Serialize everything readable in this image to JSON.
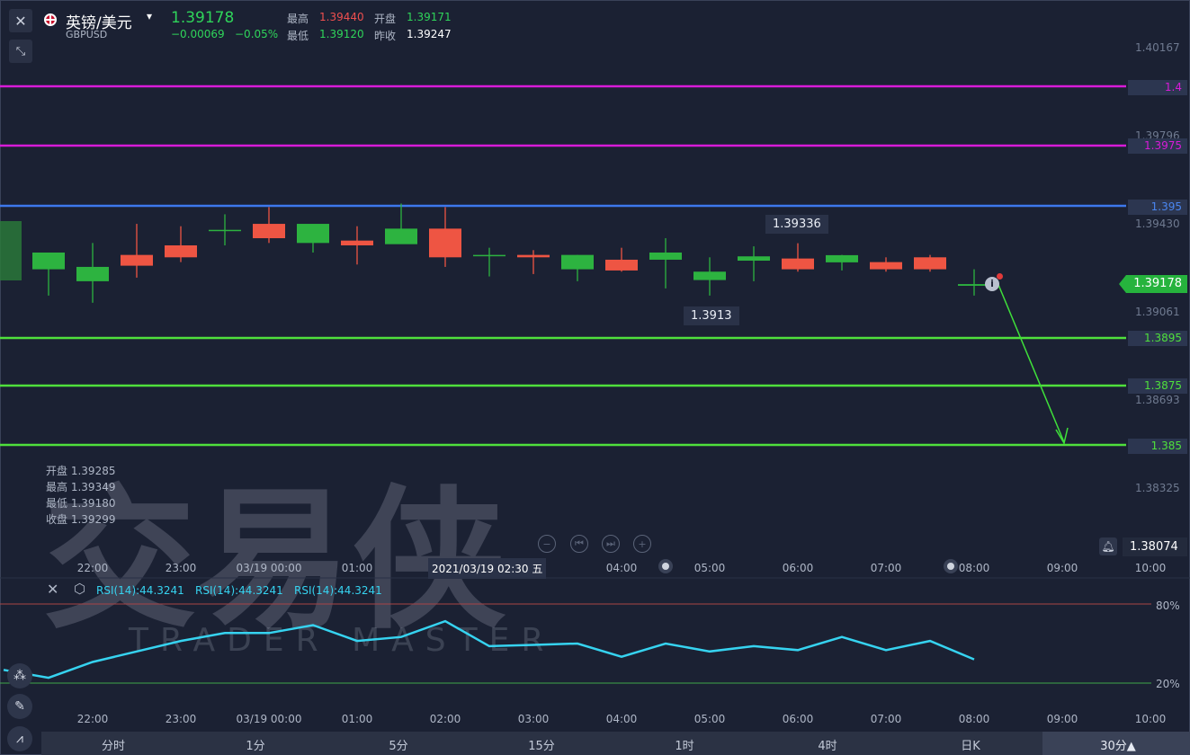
{
  "header": {
    "name": "英镑/美元",
    "caret": "▾",
    "code": "GBPUSD",
    "price": "1.39178",
    "change": "−0.00069",
    "change_pct": "−0.05%",
    "high_label": "最高",
    "high": "1.39440",
    "open_label": "开盘",
    "open": "1.39171",
    "low_label": "最低",
    "low": "1.39120",
    "prev_label": "昨收",
    "prev": "1.39247"
  },
  "axis": {
    "ticks": [
      "1.40167",
      "1.39796",
      "1.39430",
      "1.39061",
      "1.38693",
      "1.38325"
    ],
    "current": "1.39178",
    "alert_price": "1.38074"
  },
  "levels": [
    {
      "label": "1.4",
      "color": "#d81bd8"
    },
    {
      "label": "1.3975",
      "color": "#d81bd8"
    },
    {
      "label": "1.395",
      "color": "#3d78ec"
    },
    {
      "label": "1.3895",
      "color": "#4fe03c"
    },
    {
      "label": "1.3875",
      "color": "#4fe03c"
    },
    {
      "label": "1.385",
      "color": "#4fe03c"
    }
  ],
  "annotations": {
    "high_mark": "1.39336",
    "low_mark": "1.3913"
  },
  "ohlc": [
    {
      "label": "开盘",
      "value": "1.39285"
    },
    {
      "label": "最高",
      "value": "1.39349"
    },
    {
      "label": "最低",
      "value": "1.39180"
    },
    {
      "label": "收盘",
      "value": "1.39299"
    }
  ],
  "time_axis": {
    "labels": [
      "22:00",
      "23:00",
      "03/19 00:00",
      "01:00",
      "02:00",
      "03:00",
      "04:00",
      "05:00",
      "06:00",
      "07:00",
      "08:00",
      "09:00",
      "10:00"
    ],
    "crosshair": "2021/03/19 02:30 五"
  },
  "rsi": {
    "labels": [
      "RSI(14):44.3241",
      "RSI(14):44.3241",
      "RSI(14):44.3241"
    ],
    "upper": "80%",
    "lower": "20%",
    "color": "#36d3f0"
  },
  "watermark": {
    "text": "交易侠",
    "sub": "TRADER MASTER"
  },
  "tabs": [
    "分时",
    "1分",
    "5分",
    "15分",
    "1时",
    "4时",
    "日K",
    "30分▲"
  ],
  "chart_data": {
    "type": "candlestick",
    "x": [
      "21:30",
      "22:00",
      "22:30",
      "23:00",
      "23:30",
      "00:00",
      "00:30",
      "01:00",
      "01:30",
      "02:00",
      "02:30",
      "03:00",
      "03:30",
      "04:00",
      "04:30",
      "05:00",
      "05:30",
      "06:00",
      "06:30",
      "07:00",
      "07:30",
      "08:00"
    ],
    "series": [
      {
        "open": [
          1.3924,
          1.3919,
          1.393,
          1.3934,
          1.39405,
          1.3943,
          1.3935,
          1.3936,
          1.39345,
          1.3941,
          1.393,
          1.393,
          1.3924,
          1.3928,
          1.3928,
          1.39195,
          1.39276,
          1.39285,
          1.39269,
          1.3927,
          1.3929,
          1.39171
        ],
        "high": [
          1.393,
          1.3935,
          1.3943,
          1.3942,
          1.3947,
          1.395,
          1.3941,
          1.3942,
          1.39515,
          1.395,
          1.3933,
          1.3932,
          1.393,
          1.3933,
          1.3937,
          1.3929,
          1.39336,
          1.39349,
          1.393,
          1.3929,
          1.393,
          1.3924
        ],
        "low": [
          1.3913,
          1.391,
          1.39205,
          1.3927,
          1.3934,
          1.3935,
          1.3931,
          1.3926,
          1.3936,
          1.3925,
          1.3921,
          1.3922,
          1.3919,
          1.3923,
          1.3916,
          1.3913,
          1.3919,
          1.3923,
          1.39235,
          1.3923,
          1.3923,
          1.3913
        ],
        "close": [
          1.3931,
          1.3925,
          1.39255,
          1.3929,
          1.39405,
          1.3937,
          1.3943,
          1.3934,
          1.3941,
          1.3929,
          1.393,
          1.3929,
          1.393,
          1.39235,
          1.3931,
          1.3923,
          1.39294,
          1.3924,
          1.39299,
          1.3924,
          1.3924,
          1.39178
        ]
      }
    ],
    "y_ticks": [
      1.40167,
      1.39796,
      1.3943,
      1.39061,
      1.38693,
      1.38325
    ],
    "ylim": [
      1.379,
      1.403
    ],
    "rsi_values": [
      30,
      24,
      36,
      44,
      52,
      58,
      58,
      64,
      52,
      55,
      67,
      48,
      49,
      50,
      40,
      50,
      44,
      48,
      45,
      55,
      45,
      52,
      38
    ],
    "rsi_ylim": [
      0,
      100
    ]
  }
}
